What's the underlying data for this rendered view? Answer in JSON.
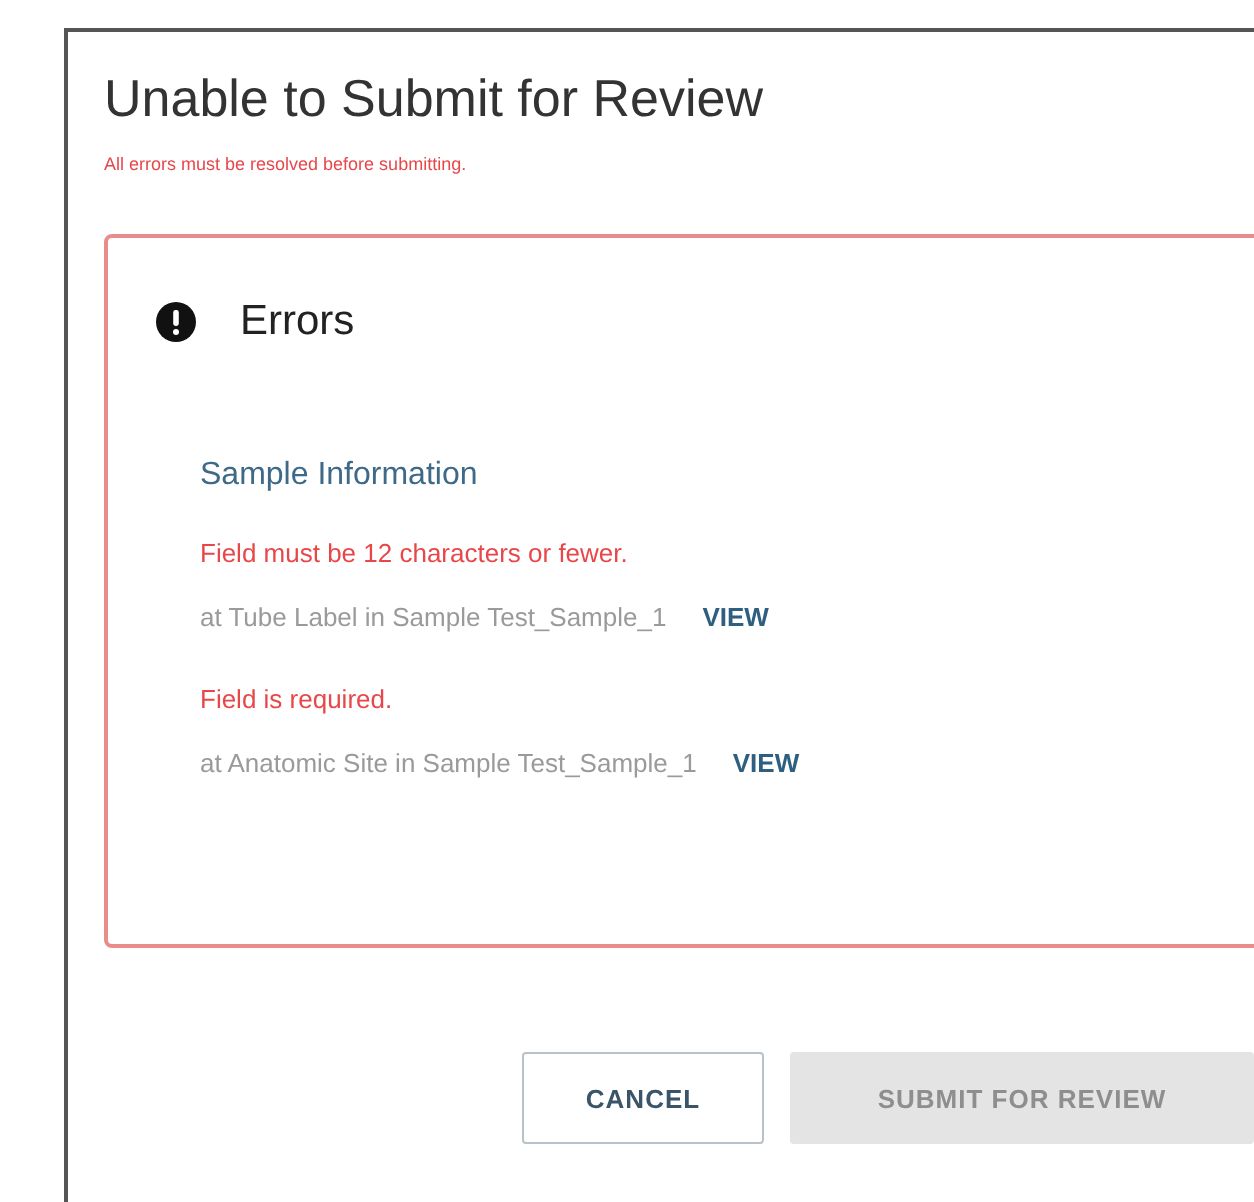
{
  "dialog": {
    "title": "Unable to Submit for Review",
    "subtitle": "All errors must be resolved before submitting."
  },
  "errors_panel": {
    "heading": "Errors",
    "sections": [
      {
        "title": "Sample Information",
        "errors": [
          {
            "message": "Field must be 12 characters or fewer.",
            "location": "at Tube Label in Sample Test_Sample_1",
            "link": "VIEW"
          },
          {
            "message": "Field is required.",
            "location": "at Anatomic Site in Sample Test_Sample_1",
            "link": "VIEW"
          }
        ]
      }
    ]
  },
  "buttons": [
    {
      "label": "CANCEL",
      "kind": "outlined",
      "disabled": false
    },
    {
      "label": "SUBMIT FOR REVIEW",
      "kind": "filled",
      "disabled": true
    }
  ]
}
